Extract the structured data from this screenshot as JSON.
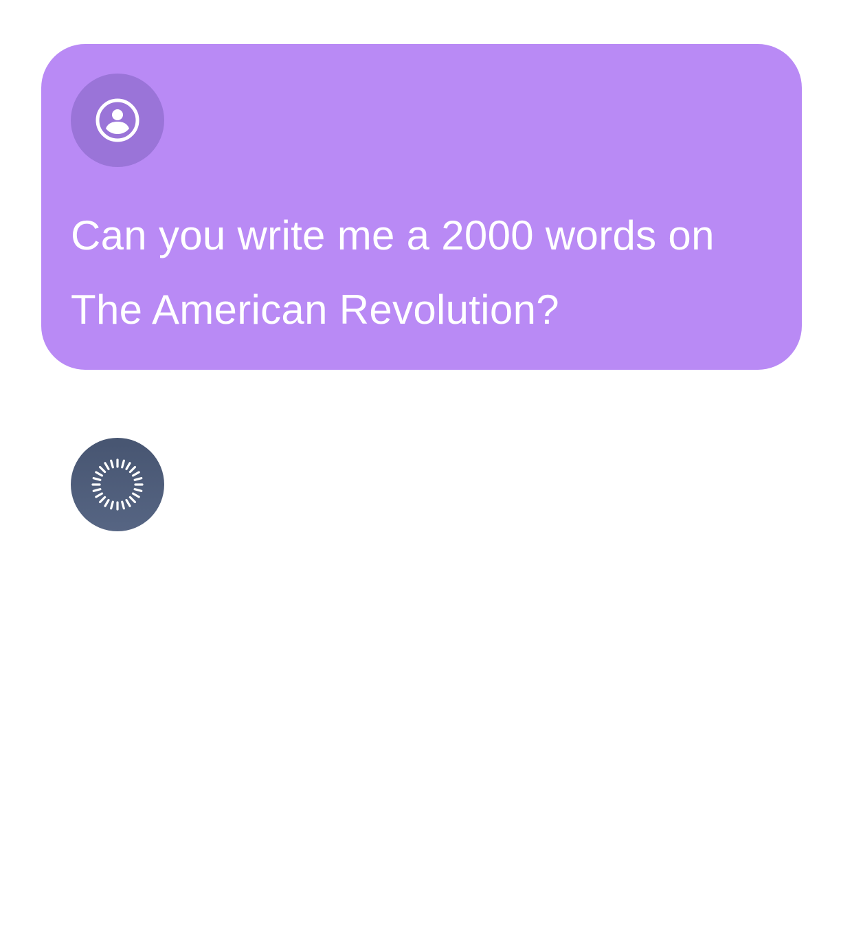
{
  "conversation": {
    "user_message": {
      "avatar_icon": "person-circle-icon",
      "text": "Can you write me a 2000 words on The American Revolution?"
    },
    "assistant_message": {
      "avatar_icon": "loading-spinner-icon",
      "state": "loading"
    }
  },
  "colors": {
    "user_bubble": "#b98af5",
    "user_avatar": "#9a74d8",
    "assistant_avatar": "#4b5a78",
    "text": "#ffffff"
  }
}
